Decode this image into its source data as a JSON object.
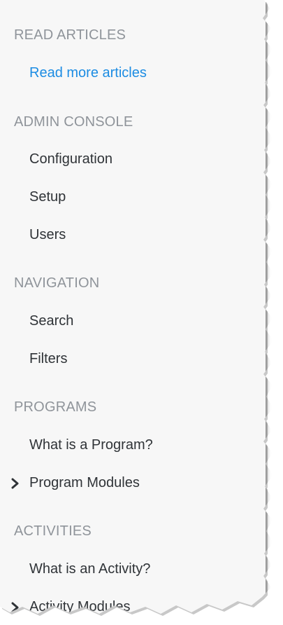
{
  "sections": [
    {
      "heading": "READ ARTICLES",
      "items": [
        {
          "label": "Read more articles",
          "link_color": "#1c8ce3"
        }
      ]
    },
    {
      "heading": "ADMIN CONSOLE",
      "items": [
        {
          "label": "Configuration"
        },
        {
          "label": "Setup"
        },
        {
          "label": "Users"
        }
      ]
    },
    {
      "heading": "NAVIGATION",
      "items": [
        {
          "label": "Search"
        },
        {
          "label": "Filters"
        }
      ]
    },
    {
      "heading": "PROGRAMS",
      "items": [
        {
          "label": "What is a Program?"
        },
        {
          "label": "Program Modules",
          "icon": "chevron-right-icon"
        }
      ]
    },
    {
      "heading": "ACTIVITIES",
      "items": [
        {
          "label": "What is an Activity?"
        },
        {
          "label": "Activity Modules",
          "icon": "chevron-right-icon"
        }
      ]
    }
  ],
  "colors": {
    "heading": "#8f949a",
    "item_text": "#2f3337",
    "link": "#1c8ce3",
    "panel_background": "#f7f7f7"
  }
}
